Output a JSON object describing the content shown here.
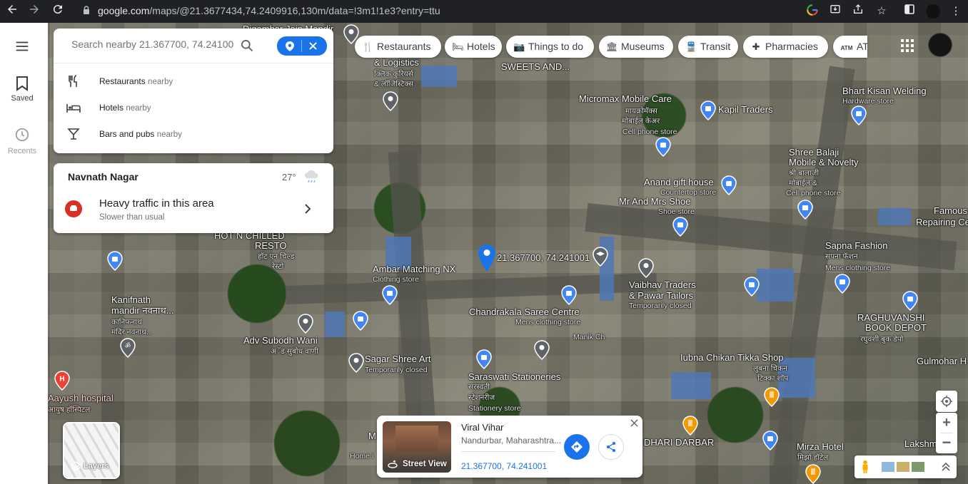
{
  "browser": {
    "url_host": "google.com",
    "url_path": "/maps/@21.3677434,74.2409916,130m/data=!3m1!1e3?entry=ttu"
  },
  "rail": {
    "saved_label": "Saved",
    "recents_label": "Recents"
  },
  "search": {
    "placeholder": "Search nearby 21.367700, 74.24100"
  },
  "suggestions": [
    {
      "name": "Restaurants",
      "suffix": "nearby",
      "icon": "restaurant-icon"
    },
    {
      "name": "Hotels",
      "suffix": "nearby",
      "icon": "hotel-icon"
    },
    {
      "name": "Bars and pubs",
      "suffix": "nearby",
      "icon": "bar-icon"
    }
  ],
  "area": {
    "name": "Navnath Nagar",
    "temperature": "27°",
    "weather_icon": "cloud-rain-icon",
    "traffic_title": "Heavy traffic in this area",
    "traffic_sub": "Slower than usual"
  },
  "chips": [
    {
      "label": "Restaurants",
      "icon": "restaurant-icon"
    },
    {
      "label": "Hotels",
      "icon": "hotel-icon"
    },
    {
      "label": "Things to do",
      "icon": "camera-icon"
    },
    {
      "label": "Museums",
      "icon": "museum-icon"
    },
    {
      "label": "Transit",
      "icon": "transit-icon"
    },
    {
      "label": "Pharmacies",
      "icon": "pharmacy-icon"
    },
    {
      "label": "ATI",
      "icon": "atm-icon"
    }
  ],
  "map_labels": {
    "l1": "& Logistics",
    "l1b": "क्लिक कुरियर्स",
    "l1c": "& लॉजिस्टिक्स",
    "l2": "SWEETS AND...",
    "l3": "Micromax Mobile Care",
    "l3b": "मायक्रोमॅक्स",
    "l3c": "मोबाईल केअर",
    "l3d": "Cell phone store",
    "l4": "Kapil Traders",
    "l5": "Bhart Kisan Welding",
    "l5b": "Hardware store",
    "l6": "Shree Balaji",
    "l6b": "Mobile & Novelty",
    "l6c": "श्री बालाजी",
    "l6d": "मोबाईल &",
    "l6e": "Cell phone store",
    "l7": "Anand gift house",
    "l7b": "Countertop store",
    "l8": "Mr And Mrs Shoe",
    "l8b": "Shoe store",
    "l9": "Famous",
    "l9b": "Repairing Ce",
    "l10": "HOT N CHILLED",
    "l10b": "RESTO",
    "l10c": "हॉट एन चिल्ड",
    "l10d": "रेस्टो",
    "l11": "21.367700, 74.241001",
    "l12": "Ambar Matching NX",
    "l12b": "Clothing store",
    "l13": "Sapna Fashion",
    "l13b": "सपना फॅशन",
    "l13c": "Mens clothing store",
    "l14": "Vaibhav Traders",
    "l14b": "& Pawar Tailors",
    "l14c": "Temporarily closed",
    "l15": "Kanifnath",
    "l15b": "mandir नवनाथ...",
    "l15c": "कानिफनाथ",
    "l15d": "मंदिर नवनाथ...",
    "l16": "Chandrakala Saree Centre",
    "l16b": "Mens clothing store",
    "l17": "RAGHUVANSHI",
    "l17b": "BOOK DEPOT",
    "l17c": "रघुवंशी बुक डेपो",
    "l18": "Manik Ch",
    "l19": "Adv Subodh Wani",
    "l19b": "अॅड सुबोध वाणी",
    "l20": "Sagar Shree Art",
    "l20b": "Temporarily closed",
    "l21": "Iubna Chikan Tikka Shop",
    "l21b": "लुबना चिकन",
    "l21c": "टिक्का शॉप",
    "l22": "Gulmohar H",
    "l23": "Saraswati Stationeries",
    "l23b": "सरस्वती",
    "l23c": "स्टेशनरीज",
    "l23d": "Stationery store",
    "l24": "Aayush hospital",
    "l24b": "आयुष हॉस्पिटल",
    "l25": "DHARI DARBAR",
    "l26": "Mirza Hotel",
    "l26b": "मिर्झा हॉटेल",
    "l27": "Lakshm",
    "l28": "Home i",
    "l29": "M",
    "l30": "Digambar Jain Mandir"
  },
  "place_card": {
    "name": "Viral Vihar",
    "address": "Nandurbar, Maharashtra...",
    "coords": "21.367700, 74.241001",
    "street_view_label": "Street View"
  },
  "layers_label": "Layers"
}
